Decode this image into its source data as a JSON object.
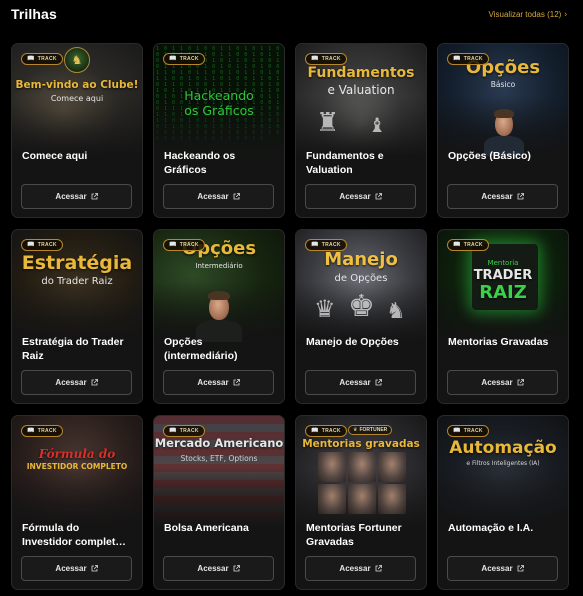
{
  "header": {
    "title": "Trilhas",
    "view_all": "Visualizar todas (12)"
  },
  "badge_label": "TRACK",
  "button_label": "Acessar",
  "cards": [
    {
      "name": "Comece aqui",
      "cover_title": "Bem-vindo ao Clube!",
      "cover_sub": "Comece aqui"
    },
    {
      "name": "Hackeando os Gráficos",
      "cover_title": "Hackeando",
      "cover_sub": "os Gráficos"
    },
    {
      "name": "Fundamentos e Valuation",
      "cover_title": "Fundamentos",
      "cover_sub": "e Valuation"
    },
    {
      "name": "Opções (Básico)",
      "cover_title": "Opções",
      "cover_sub": "Básico"
    },
    {
      "name": "Estratégia do Trader Raiz",
      "cover_title": "Estratégia",
      "cover_sub": "do Trader Raiz"
    },
    {
      "name": "Opções (intermediário)",
      "cover_title": "Opções",
      "cover_sub": "Intermediário"
    },
    {
      "name": "Manejo de Opções",
      "cover_title": "Manejo",
      "cover_sub": "de Opções"
    },
    {
      "name": "Mentorias Gravadas",
      "cover_title": "TRADER",
      "cover_title2": "RAIZ",
      "cover_sub": "Mentoria"
    },
    {
      "name": "Fórmula do Investidor completo",
      "cover_title": "Fórmula do",
      "cover_sub": "INVESTIDOR COMPLETO"
    },
    {
      "name": "Bolsa Americana",
      "cover_title": "Mercado Americano",
      "cover_sub": "Stocks, ETF, Options"
    },
    {
      "name": "Mentorias Fortuner Gravadas",
      "cover_title": "Mentorias gravadas",
      "cover_tag": "FORTUNER"
    },
    {
      "name": "Automação e I.A.",
      "cover_title": "Automação",
      "cover_sub": "e Filtros Inteligentes (IA)"
    }
  ]
}
